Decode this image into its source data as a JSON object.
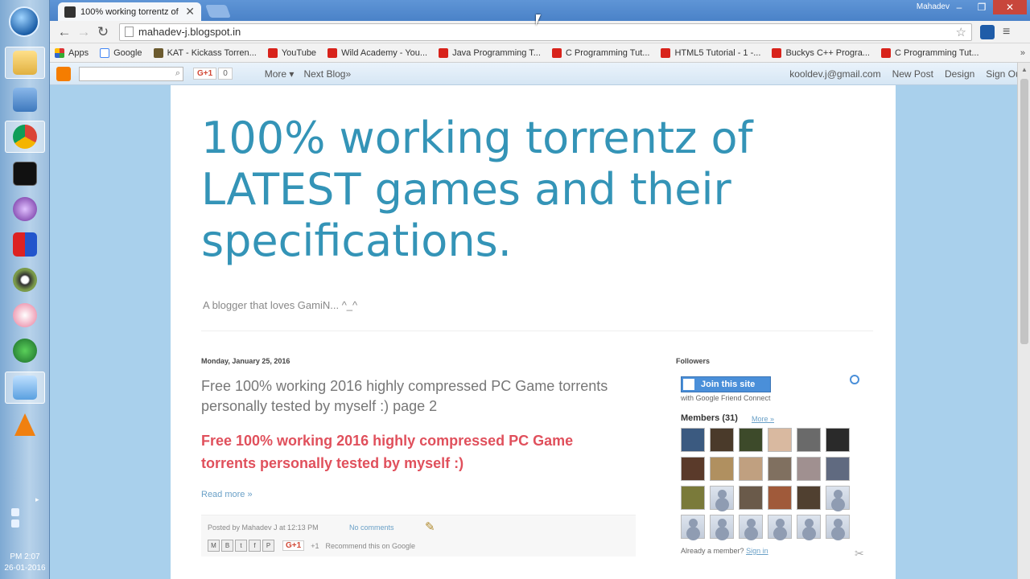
{
  "window": {
    "user": "Mahadev"
  },
  "tab": {
    "title": "100% working torrentz of"
  },
  "address": {
    "url": "mahadev-j.blogspot.in"
  },
  "bookmarks": [
    {
      "label": "Apps",
      "icon": "apps"
    },
    {
      "label": "Google",
      "icon": "goog"
    },
    {
      "label": "KAT - Kickass Torren...",
      "icon": "kat"
    },
    {
      "label": "YouTube",
      "icon": "yt"
    },
    {
      "label": "Wild Academy - You...",
      "icon": "yt"
    },
    {
      "label": "Java Programming T...",
      "icon": "yt"
    },
    {
      "label": "C Programming Tut...",
      "icon": "yt"
    },
    {
      "label": "HTML5 Tutorial - 1 -...",
      "icon": "yt"
    },
    {
      "label": "Buckys C++ Progra...",
      "icon": "yt"
    },
    {
      "label": "C Programming Tut...",
      "icon": "yt"
    }
  ],
  "bookmarks_more": "»",
  "navbar": {
    "gplus": "G+1",
    "gcount": "0",
    "more": "More ▾",
    "next_blog": "Next Blog»",
    "email": "kooldev.j@gmail.com",
    "new_post": "New Post",
    "design": "Design",
    "sign_out": "Sign Out"
  },
  "blog": {
    "title": "100% working torrentz of LATEST games and their specifications.",
    "description": "A blogger that loves GamiN... ^_^"
  },
  "post": {
    "date": "Monday, January 25, 2016",
    "title": "Free 100% working 2016 highly compressed PC Game torrents personally tested by myself :) page 2",
    "body": " Free 100% working  2016 highly compressed  PC Game torrents personally tested by myself :)",
    "read_more": "Read more »",
    "posted_by": "Posted by Mahadev J at 12:13 PM",
    "comments": "No comments",
    "share": [
      "M",
      "B",
      "t",
      "f",
      "P"
    ],
    "gplus": "G+1",
    "count": "+1",
    "recommend": "Recommend this on Google"
  },
  "sidebar": {
    "title": "Followers",
    "join": "Join this site",
    "join_sub": "with Google Friend Connect",
    "members": "Members (31)",
    "more": "More »",
    "already": "Already a member?",
    "signin": "Sign in",
    "avatars": [
      "#3b5a80",
      "#4a3a2a",
      "#3d4a2a",
      "#d9b9a0",
      "#6a6a6a",
      "#2a2a2a",
      "#5a3a2a",
      "#b09060",
      "#c0a080",
      "#807060",
      "#a09090",
      "#606a80",
      "#7a7a3a",
      "blank",
      "#6a5a4a",
      "#a05a3a",
      "#504030",
      "blank",
      "blank",
      "blank",
      "blank",
      "blank",
      "blank",
      "blank"
    ]
  },
  "taskbar": {
    "time": "PM 2:07",
    "date": "26-01-2016"
  },
  "colors": {
    "blog_title": "#3494b7",
    "post_body": "#e0505c",
    "link": "#6aa0c7"
  }
}
